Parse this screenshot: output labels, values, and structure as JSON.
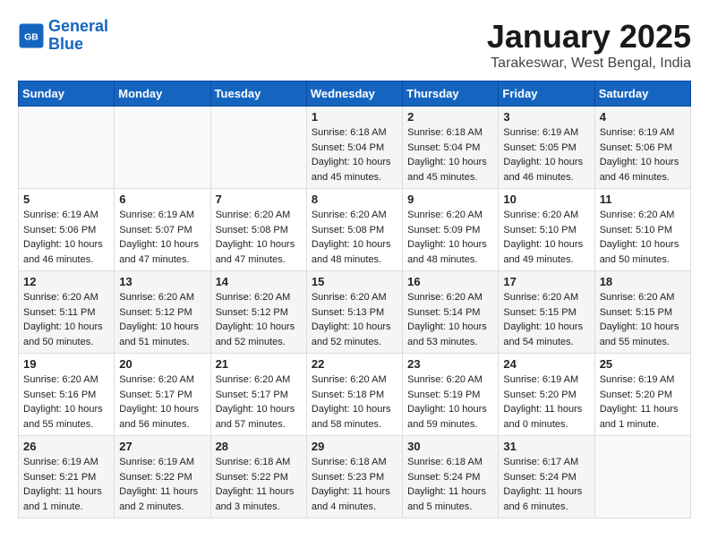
{
  "header": {
    "logo_line1": "General",
    "logo_line2": "Blue",
    "month": "January 2025",
    "location": "Tarakeswar, West Bengal, India"
  },
  "weekdays": [
    "Sunday",
    "Monday",
    "Tuesday",
    "Wednesday",
    "Thursday",
    "Friday",
    "Saturday"
  ],
  "weeks": [
    [
      {
        "day": "",
        "info": ""
      },
      {
        "day": "",
        "info": ""
      },
      {
        "day": "",
        "info": ""
      },
      {
        "day": "1",
        "info": "Sunrise: 6:18 AM\nSunset: 5:04 PM\nDaylight: 10 hours\nand 45 minutes."
      },
      {
        "day": "2",
        "info": "Sunrise: 6:18 AM\nSunset: 5:04 PM\nDaylight: 10 hours\nand 45 minutes."
      },
      {
        "day": "3",
        "info": "Sunrise: 6:19 AM\nSunset: 5:05 PM\nDaylight: 10 hours\nand 46 minutes."
      },
      {
        "day": "4",
        "info": "Sunrise: 6:19 AM\nSunset: 5:06 PM\nDaylight: 10 hours\nand 46 minutes."
      }
    ],
    [
      {
        "day": "5",
        "info": "Sunrise: 6:19 AM\nSunset: 5:06 PM\nDaylight: 10 hours\nand 46 minutes."
      },
      {
        "day": "6",
        "info": "Sunrise: 6:19 AM\nSunset: 5:07 PM\nDaylight: 10 hours\nand 47 minutes."
      },
      {
        "day": "7",
        "info": "Sunrise: 6:20 AM\nSunset: 5:08 PM\nDaylight: 10 hours\nand 47 minutes."
      },
      {
        "day": "8",
        "info": "Sunrise: 6:20 AM\nSunset: 5:08 PM\nDaylight: 10 hours\nand 48 minutes."
      },
      {
        "day": "9",
        "info": "Sunrise: 6:20 AM\nSunset: 5:09 PM\nDaylight: 10 hours\nand 48 minutes."
      },
      {
        "day": "10",
        "info": "Sunrise: 6:20 AM\nSunset: 5:10 PM\nDaylight: 10 hours\nand 49 minutes."
      },
      {
        "day": "11",
        "info": "Sunrise: 6:20 AM\nSunset: 5:10 PM\nDaylight: 10 hours\nand 50 minutes."
      }
    ],
    [
      {
        "day": "12",
        "info": "Sunrise: 6:20 AM\nSunset: 5:11 PM\nDaylight: 10 hours\nand 50 minutes."
      },
      {
        "day": "13",
        "info": "Sunrise: 6:20 AM\nSunset: 5:12 PM\nDaylight: 10 hours\nand 51 minutes."
      },
      {
        "day": "14",
        "info": "Sunrise: 6:20 AM\nSunset: 5:12 PM\nDaylight: 10 hours\nand 52 minutes."
      },
      {
        "day": "15",
        "info": "Sunrise: 6:20 AM\nSunset: 5:13 PM\nDaylight: 10 hours\nand 52 minutes."
      },
      {
        "day": "16",
        "info": "Sunrise: 6:20 AM\nSunset: 5:14 PM\nDaylight: 10 hours\nand 53 minutes."
      },
      {
        "day": "17",
        "info": "Sunrise: 6:20 AM\nSunset: 5:15 PM\nDaylight: 10 hours\nand 54 minutes."
      },
      {
        "day": "18",
        "info": "Sunrise: 6:20 AM\nSunset: 5:15 PM\nDaylight: 10 hours\nand 55 minutes."
      }
    ],
    [
      {
        "day": "19",
        "info": "Sunrise: 6:20 AM\nSunset: 5:16 PM\nDaylight: 10 hours\nand 55 minutes."
      },
      {
        "day": "20",
        "info": "Sunrise: 6:20 AM\nSunset: 5:17 PM\nDaylight: 10 hours\nand 56 minutes."
      },
      {
        "day": "21",
        "info": "Sunrise: 6:20 AM\nSunset: 5:17 PM\nDaylight: 10 hours\nand 57 minutes."
      },
      {
        "day": "22",
        "info": "Sunrise: 6:20 AM\nSunset: 5:18 PM\nDaylight: 10 hours\nand 58 minutes."
      },
      {
        "day": "23",
        "info": "Sunrise: 6:20 AM\nSunset: 5:19 PM\nDaylight: 10 hours\nand 59 minutes."
      },
      {
        "day": "24",
        "info": "Sunrise: 6:19 AM\nSunset: 5:20 PM\nDaylight: 11 hours\nand 0 minutes."
      },
      {
        "day": "25",
        "info": "Sunrise: 6:19 AM\nSunset: 5:20 PM\nDaylight: 11 hours\nand 1 minute."
      }
    ],
    [
      {
        "day": "26",
        "info": "Sunrise: 6:19 AM\nSunset: 5:21 PM\nDaylight: 11 hours\nand 1 minute."
      },
      {
        "day": "27",
        "info": "Sunrise: 6:19 AM\nSunset: 5:22 PM\nDaylight: 11 hours\nand 2 minutes."
      },
      {
        "day": "28",
        "info": "Sunrise: 6:18 AM\nSunset: 5:22 PM\nDaylight: 11 hours\nand 3 minutes."
      },
      {
        "day": "29",
        "info": "Sunrise: 6:18 AM\nSunset: 5:23 PM\nDaylight: 11 hours\nand 4 minutes."
      },
      {
        "day": "30",
        "info": "Sunrise: 6:18 AM\nSunset: 5:24 PM\nDaylight: 11 hours\nand 5 minutes."
      },
      {
        "day": "31",
        "info": "Sunrise: 6:17 AM\nSunset: 5:24 PM\nDaylight: 11 hours\nand 6 minutes."
      },
      {
        "day": "",
        "info": ""
      }
    ]
  ]
}
